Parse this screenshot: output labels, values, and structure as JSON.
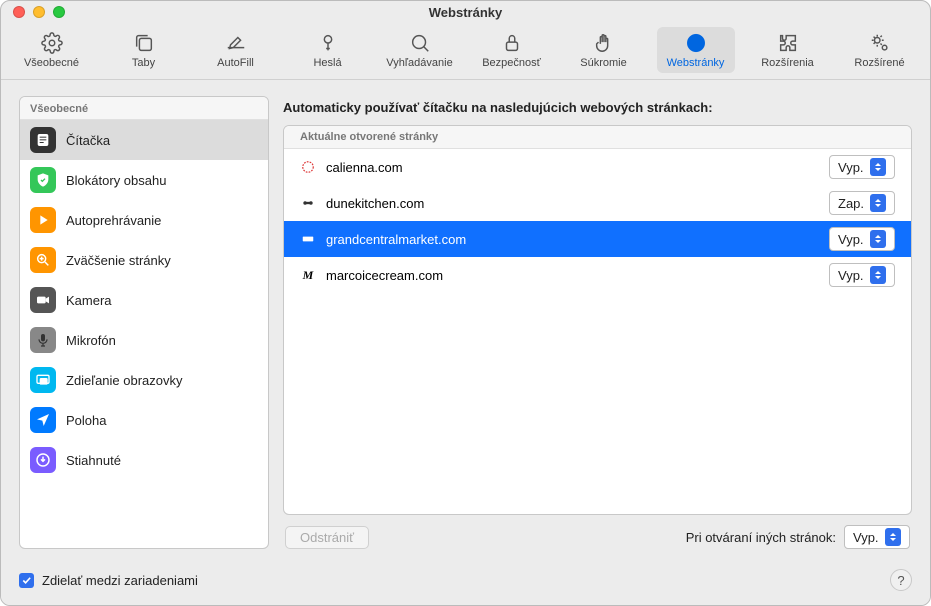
{
  "window": {
    "title": "Webstránky"
  },
  "toolbar": {
    "items": [
      {
        "name": "vseobecne",
        "label": "Všeobecné"
      },
      {
        "name": "taby",
        "label": "Taby"
      },
      {
        "name": "autofill",
        "label": "AutoFill"
      },
      {
        "name": "hesla",
        "label": "Heslá"
      },
      {
        "name": "vyhladavanie",
        "label": "Vyhľadávanie"
      },
      {
        "name": "bezpecnost",
        "label": "Bezpečnosť"
      },
      {
        "name": "sukromie",
        "label": "Súkromie"
      },
      {
        "name": "webstranky",
        "label": "Webstránky"
      },
      {
        "name": "rozsirenia",
        "label": "Rozšírenia"
      },
      {
        "name": "rozsirene",
        "label": "Rozšírené"
      }
    ]
  },
  "sidebar": {
    "header": "Všeobecné",
    "items": [
      {
        "name": "citacka",
        "label": "Čítačka"
      },
      {
        "name": "blokatory",
        "label": "Blokátory obsahu"
      },
      {
        "name": "autoprehravanie",
        "label": "Autoprehrávanie"
      },
      {
        "name": "zvacsenie",
        "label": "Zväčšenie stránky"
      },
      {
        "name": "kamera",
        "label": "Kamera"
      },
      {
        "name": "mikrofon",
        "label": "Mikrofón"
      },
      {
        "name": "zdielanie",
        "label": "Zdieľanie obrazovky"
      },
      {
        "name": "poloha",
        "label": "Poloha"
      },
      {
        "name": "stiahnute",
        "label": "Stiahnuté"
      }
    ]
  },
  "main": {
    "title": "Automaticky používať čítačku na nasledujúcich webových stránkach:",
    "table_header": "Aktuálne otvorené stránky",
    "sites": [
      {
        "name": "calienna.com",
        "status": "Vyp."
      },
      {
        "name": "dunekitchen.com",
        "status": "Zap."
      },
      {
        "name": "grandcentralmarket.com",
        "status": "Vyp."
      },
      {
        "name": "marcoicecream.com",
        "status": "Vyp."
      }
    ],
    "delete_label": "Odstrániť",
    "default_label": "Pri otváraní iných stránok:",
    "default_value": "Vyp."
  },
  "footer": {
    "share_label": "Zdielať medzi zariadeniami"
  }
}
